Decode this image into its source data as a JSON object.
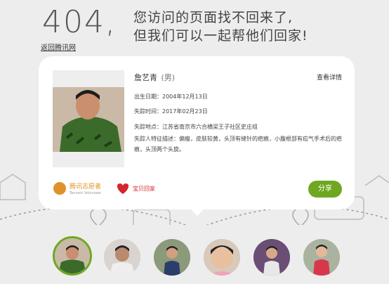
{
  "header": {
    "code": "404,",
    "line1": "您访问的页面找不回来了,",
    "line2": "但我们可以一起帮他们回家!",
    "back_link": "返回腾讯网"
  },
  "card": {
    "name": "詹艺青",
    "gender": "(男)",
    "detail_link": "查看详情",
    "birth": "出生日期：2004年12月13日",
    "missing_time": "失踪时间：2017年02月23日",
    "missing_place": "失踪地点：江苏省南京市六合横梁王子社区史庄组",
    "features": "失踪人特征描述：偏瘦，皮肤较黄，头顶有缝针的疤痕，小腹根部有疝气手术后的疤痕，头顶两个头旋。",
    "logo_tencent": "腾讯志愿者",
    "logo_tencent_sub": "Tencent Volunteer",
    "logo_baobei": "宝贝回家",
    "share_label": "分享"
  },
  "thumbnails": [
    {
      "label": "child-1",
      "active": true
    },
    {
      "label": "child-2",
      "active": false
    },
    {
      "label": "child-3",
      "active": false
    },
    {
      "label": "child-4",
      "active": false
    },
    {
      "label": "child-5",
      "active": false
    },
    {
      "label": "child-6",
      "active": false
    }
  ],
  "colors": {
    "accent": "#6ea821",
    "background": "#ededed"
  }
}
